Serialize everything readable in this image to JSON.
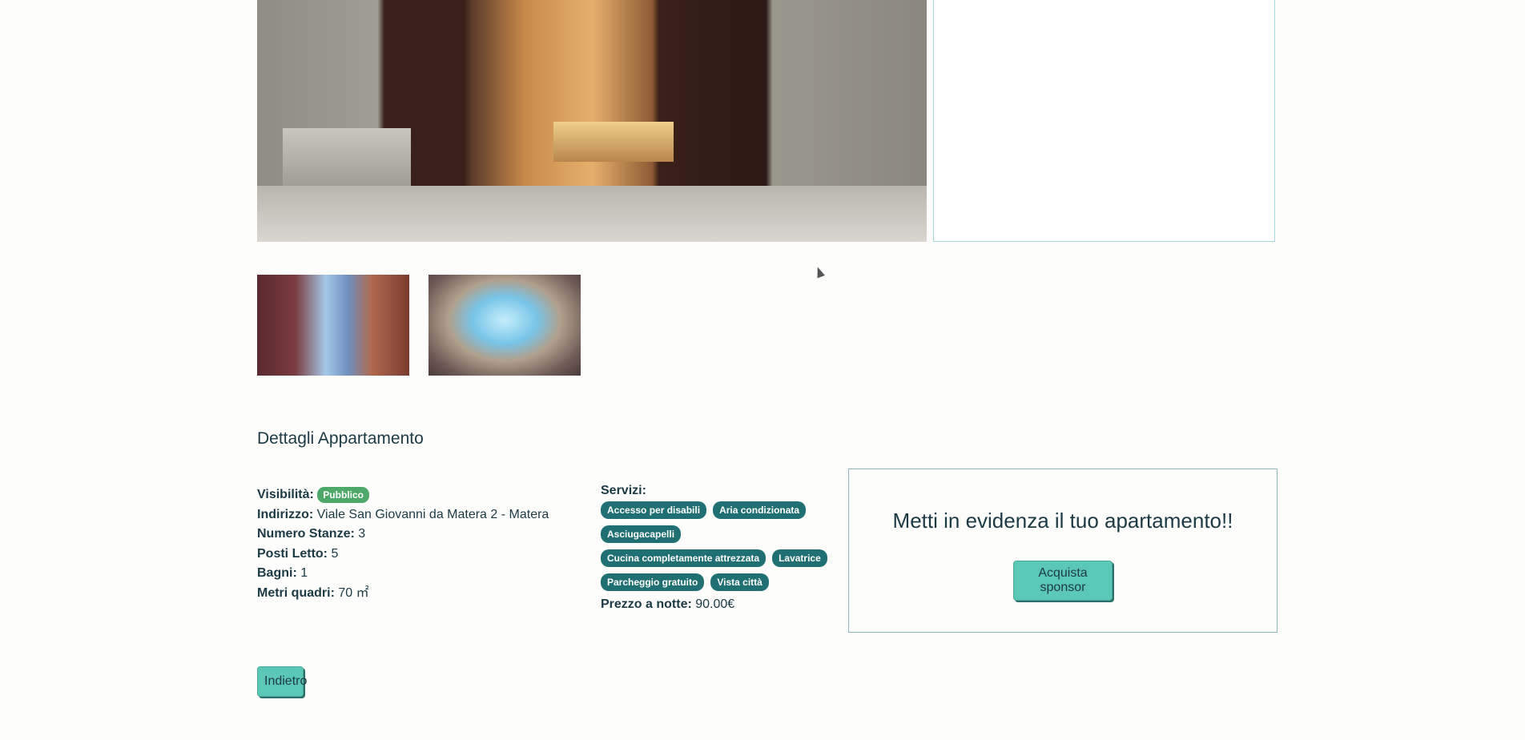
{
  "gallery": {
    "main_image": "house-entrance-photo",
    "thumbnails": [
      "stairs-photo",
      "pool-photo"
    ]
  },
  "details": {
    "title": "Dettagli Appartamento",
    "visibility_label": "Visibilità:",
    "visibility_value": "Pubblico",
    "address_label": "Indirizzo:",
    "address_value": "Viale San Giovanni da Matera 2 - Matera",
    "rooms_label": "Numero Stanze:",
    "rooms_value": "3",
    "beds_label": "Posti Letto:",
    "beds_value": "5",
    "baths_label": "Bagni:",
    "baths_value": "1",
    "sqm_label": "Metri quadri:",
    "sqm_value": "70 ㎡"
  },
  "services": {
    "label": "Servizi:",
    "items": [
      "Accesso per disabili",
      "Aria condizionata",
      "Asciugacapelli",
      "Cucina completamente attrezzata",
      "Lavatrice",
      "Parcheggio gratuito",
      "Vista città"
    ],
    "price_label": "Prezzo a notte:",
    "price_value": "90.00€"
  },
  "promo": {
    "title": "Metti in evidenza il tuo apartamento!!",
    "button": "Acquista sponsor"
  },
  "back_button": "Indietro",
  "colors": {
    "accent": "#5bc8b7",
    "chip": "#1f6f73",
    "public_badge": "#4ea86a",
    "text": "#1b3a44"
  }
}
